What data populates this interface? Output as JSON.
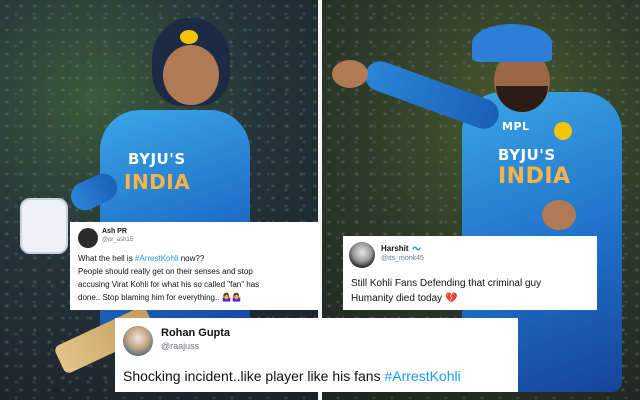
{
  "photos": {
    "left": {
      "jersey_brand": "BYJU'S",
      "jersey_team": "INDIA"
    },
    "right": {
      "jersey_brand": "BYJU'S",
      "jersey_team": "INDIA",
      "chest_mark": "MPL"
    }
  },
  "tweets": [
    {
      "id": "tweet-ash",
      "name": "Ash PR",
      "handle": "@pr_ash15",
      "lines": [
        {
          "pre": "What the hell is ",
          "hashtag": "#ArrestKohli",
          "post": " now??"
        },
        {
          "text": "People should really get on their senses and stop"
        },
        {
          "text": "accusing Virat Kohli for what his so called \"fan\" has"
        },
        {
          "text": "done.. Stop blaming him for everything.. 🤷‍♀️🤷‍♀️"
        }
      ]
    },
    {
      "id": "tweet-harshit",
      "name": "Harshit",
      "verified_icon": "blue-wave-icon",
      "handle": "@its_monk45",
      "lines": [
        {
          "text": "Still Kohli Fans Defending that criminal guy"
        },
        {
          "text": "Humanity died today 💔"
        }
      ]
    },
    {
      "id": "tweet-rohan",
      "name": "Rohan Gupta",
      "handle": "@raajuss",
      "lines": [
        {
          "pre": "Shocking incident..like player like his fans ",
          "hashtag": "#ArrestKohli",
          "post": ""
        }
      ]
    }
  ],
  "colors": {
    "hashtag": "#1d9bf0",
    "handle": "#6a7580",
    "jersey": "#2a86d8",
    "india_text": "#ffb347"
  }
}
